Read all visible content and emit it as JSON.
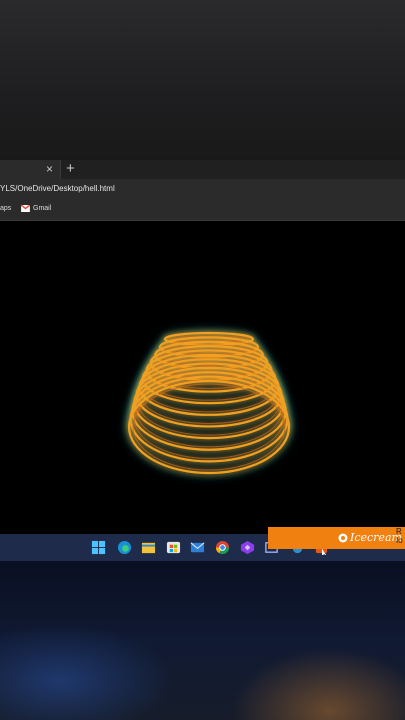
{
  "browser": {
    "tab": {
      "close_symbol": "×"
    },
    "new_tab_symbol": "+",
    "address": {
      "url": "YLS/OneDrive/Desktop/hell.html"
    },
    "bookmarks": [
      {
        "label": "aps",
        "icon": "maps-icon"
      },
      {
        "label": "Gmail",
        "icon": "gmail-icon"
      }
    ]
  },
  "animation": {
    "description_colors": {
      "outer_glow": "#2ec9c9",
      "ring_stroke": "#f0a020",
      "ring_inner": "#c9651a"
    },
    "ring_count": 12
  },
  "taskbar": {
    "icons": [
      "windows-start-icon",
      "edge-icon",
      "file-explorer-icon",
      "store-icon",
      "mail-icon",
      "chrome-icon",
      "app-purple-icon",
      "window-icon",
      "app-icon",
      "app-orange-icon"
    ]
  },
  "promo": {
    "text": "Icecream",
    "side_text_line1": "R",
    "side_text_line2": "Io",
    "bg_color": "#f08010"
  }
}
